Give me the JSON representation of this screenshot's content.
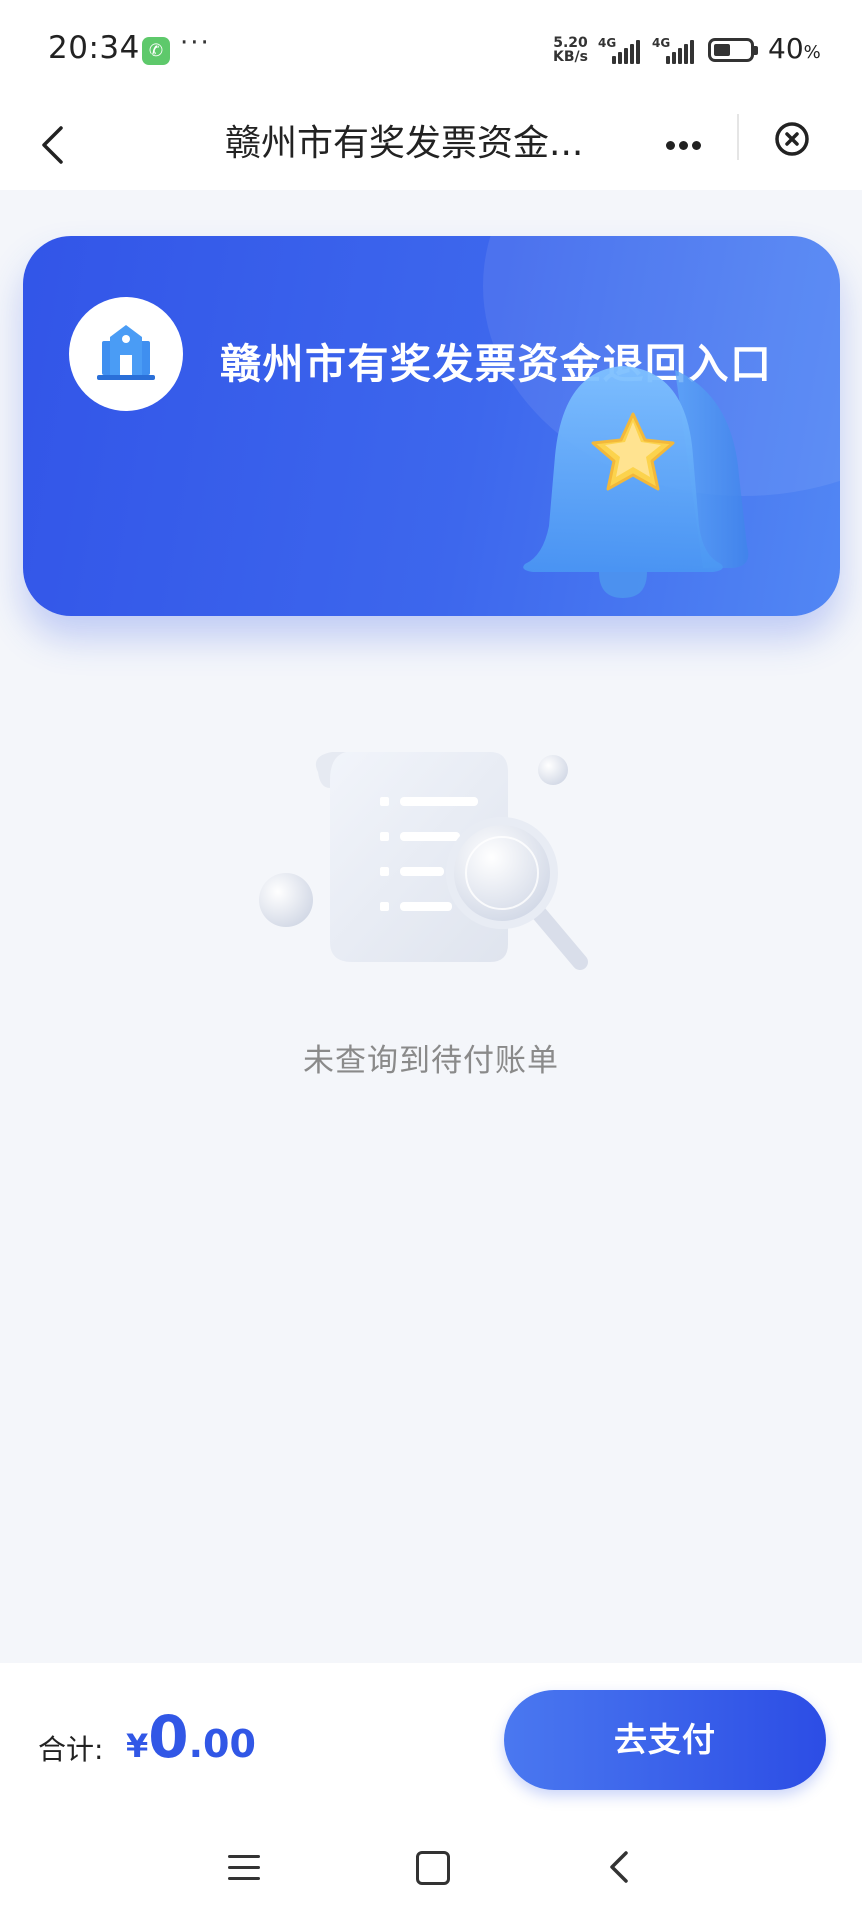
{
  "status_bar": {
    "time": "20:34",
    "phone_icon": "phone-icon",
    "more": "···",
    "speed_value": "5.20",
    "speed_unit": "KB/s",
    "sim1_label": "4G",
    "sim2_label": "4G",
    "battery_percent": "40",
    "battery_unit": "%"
  },
  "nav": {
    "title": "赣州市有奖发票资金...",
    "back_icon": "chevron-left-icon",
    "more_icon": "more-dots-icon",
    "close_icon": "close-circle-icon"
  },
  "banner": {
    "title": "赣州市有奖发票资金退回入口",
    "logo_icon": "building-icon",
    "illustration": "bell-star-icon",
    "colors": {
      "start": "#3255e8",
      "end": "#5287f4"
    }
  },
  "empty_state": {
    "illustration": "document-search-icon",
    "message": "未查询到待付账单"
  },
  "footer": {
    "total_label": "合计:",
    "currency": "¥",
    "amount_integer": "0",
    "amount_decimal": ".00",
    "pay_button": "去支付",
    "accent_color": "#3157e6"
  },
  "system_nav": {
    "menu_icon": "menu-icon",
    "home_icon": "home-square-icon",
    "back_icon": "back-triangle-icon"
  }
}
